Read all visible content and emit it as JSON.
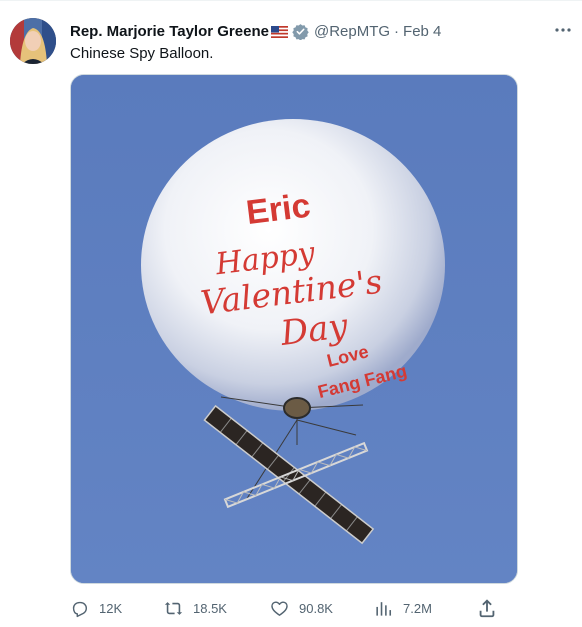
{
  "author": {
    "name": "Rep. Marjorie Taylor Greene",
    "handle": "@RepMTG",
    "separator": "·",
    "date": "Feb 4"
  },
  "tweet": {
    "text": "Chinese Spy Balloon."
  },
  "media": {
    "overlay_name": "Eric",
    "greeting_line1": "Happy",
    "greeting_line2": "Valentine's",
    "greeting_line3": "Day",
    "signoff_line1": "Love",
    "signoff_line2": "Fang Fang"
  },
  "actions": {
    "replies": "12K",
    "retweets": "18.5K",
    "likes": "90.8K",
    "views": "7.2M"
  },
  "icons": {
    "more": "more-options-icon",
    "verified": "verified-badge-icon",
    "flag": "us-flag-icon",
    "reply": "reply-icon",
    "retweet": "retweet-icon",
    "like": "heart-icon",
    "views": "analytics-icon",
    "share": "share-icon"
  },
  "colors": {
    "sky": "#5e7fbf",
    "text_red": "#d43a34",
    "secondary": "#536471",
    "verified_gray": "#829aab"
  }
}
